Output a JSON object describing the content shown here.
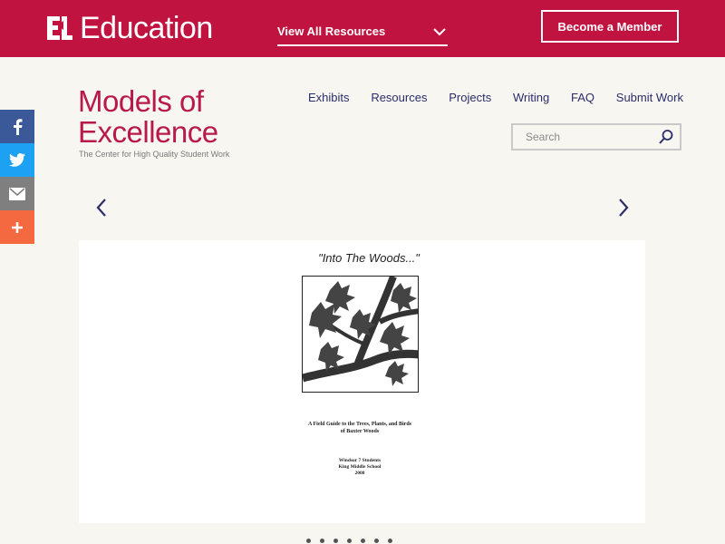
{
  "header": {
    "brand_mark": "EL",
    "brand_text": "Education",
    "resources_label": "View All Resources",
    "member_button": "Become a Member"
  },
  "share": [
    {
      "icon": "facebook-icon",
      "label": "f"
    },
    {
      "icon": "twitter-icon",
      "label": ""
    },
    {
      "icon": "email-icon",
      "label": ""
    },
    {
      "icon": "plus-icon",
      "label": "+"
    }
  ],
  "site": {
    "title_line1": "Models of",
    "title_line2": "Excellence",
    "subtitle": "The Center for High Quality Student Work"
  },
  "nav": {
    "items": [
      "Exhibits",
      "Resources",
      "Projects",
      "Writing",
      "FAQ",
      "Submit Work"
    ]
  },
  "search": {
    "placeholder": "Search"
  },
  "slide": {
    "doc_title": "\"Into The Woods...\"",
    "doc_sub_line1": "A Field Guide to the Trees, Plants, and Birds",
    "doc_sub_line2": "of Baxter Woods",
    "school_line1": "Windsor 7 Students",
    "school_line2": "King Middle School",
    "school_line3": "2000"
  },
  "colors": {
    "brand": "#c1133f",
    "title": "#b8194a",
    "nav": "#2b2d6b",
    "facebook": "#3b5998",
    "twitter": "#1da1f2",
    "email": "#7f7f7f",
    "plus": "#f4693f"
  }
}
